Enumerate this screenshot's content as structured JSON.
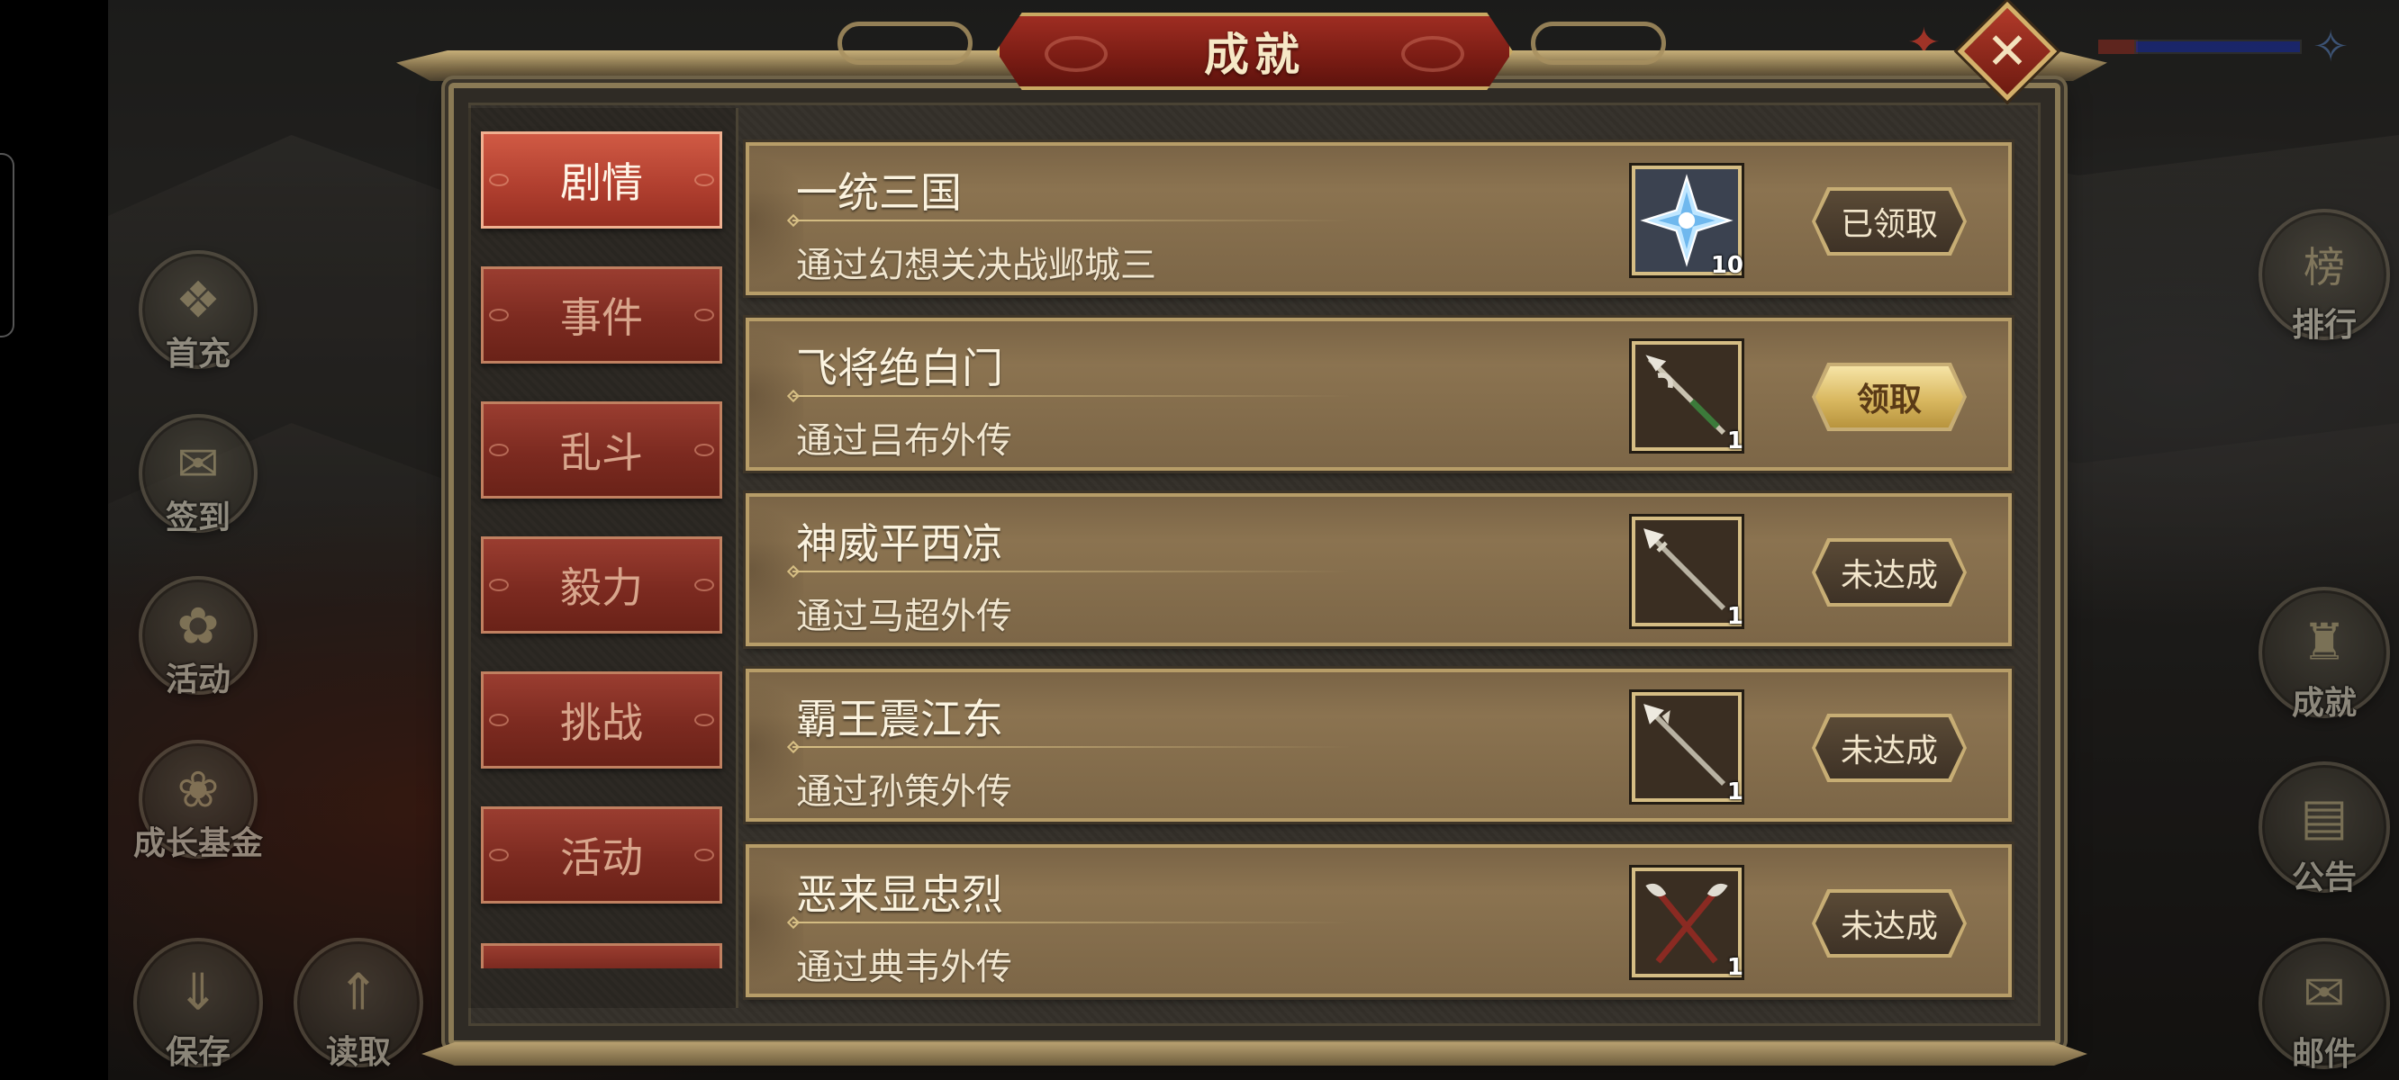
{
  "title": "成就",
  "close_icon": "close-x-icon",
  "side_left": [
    {
      "label": "首充",
      "icon": "treasure-icon"
    },
    {
      "label": "签到",
      "icon": "scroll-icon"
    },
    {
      "label": "活动",
      "icon": "flower-icon"
    },
    {
      "label": "成长基金",
      "icon": "plant-icon"
    },
    {
      "label": "保存",
      "icon": "save-icon"
    },
    {
      "label": "读取",
      "icon": "load-icon"
    }
  ],
  "side_right": [
    {
      "label": "排行",
      "icon": "ranking-icon",
      "glyph_text": "榜"
    },
    {
      "label": "成就",
      "icon": "achievement-icon"
    },
    {
      "label": "公告",
      "icon": "notice-icon"
    },
    {
      "label": "邮件",
      "icon": "mail-icon"
    }
  ],
  "tabs": [
    {
      "label": "剧情",
      "active": true
    },
    {
      "label": "事件",
      "active": false
    },
    {
      "label": "乱斗",
      "active": false
    },
    {
      "label": "毅力",
      "active": false
    },
    {
      "label": "挑战",
      "active": false
    },
    {
      "label": "活动",
      "active": false
    }
  ],
  "achievements": [
    {
      "name": "一统三国",
      "desc": "通过幻想关决战邺城三",
      "reward_icon": "crystal-icon",
      "reward_count": "10",
      "button": "已领取",
      "state": "claimed"
    },
    {
      "name": "飞将绝白门",
      "desc": "通过吕布外传",
      "reward_icon": "halberd-icon",
      "reward_count": "1",
      "button": "领取",
      "state": "claim"
    },
    {
      "name": "神威平西凉",
      "desc": "通过马超外传",
      "reward_icon": "spear-icon",
      "reward_count": "1",
      "button": "未达成",
      "state": "locked"
    },
    {
      "name": "霸王震江东",
      "desc": "通过孙策外传",
      "reward_icon": "spear-icon",
      "reward_count": "1",
      "button": "未达成",
      "state": "locked"
    },
    {
      "name": "恶来显忠烈",
      "desc": "通过典韦外传",
      "reward_icon": "twin-axes-icon",
      "reward_count": "1",
      "button": "未达成",
      "state": "locked"
    }
  ]
}
